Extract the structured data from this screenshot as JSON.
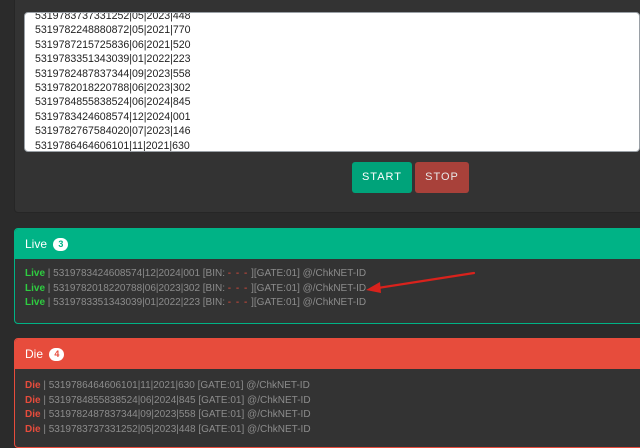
{
  "input": {
    "lines": [
      "5319783737331252|05|2023|448",
      "5319782248880872|05|2021|770",
      "5319787215725836|06|2021|520",
      "5319783351343039|01|2022|223",
      "5319782487837344|09|2023|558",
      "5319782018220788|06|2023|302",
      "5319784855838524|06|2024|845",
      "5319783424608574|12|2024|001",
      "5319782767584020|07|2023|146",
      "5319786464606101|11|2021|630"
    ]
  },
  "buttons": {
    "start": "START",
    "stop": "STOP"
  },
  "live": {
    "title": "Live",
    "count": "3",
    "rows": [
      {
        "status": "Live",
        "text": " | 5319783424608574|12|2024|001 [BIN: ",
        "bin": "- - -",
        "suffix": " ][GATE:01] @/ChkNET-ID"
      },
      {
        "status": "Live",
        "text": " | 5319782018220788|06|2023|302 [BIN: ",
        "bin": "- - -",
        "suffix": " ][GATE:01] @/ChkNET-ID"
      },
      {
        "status": "Live",
        "text": " | 5319783351343039|01|2022|223 [BIN: ",
        "bin": "- - -",
        "suffix": " ][GATE:01] @/ChkNET-ID"
      }
    ]
  },
  "die": {
    "title": "Die",
    "count": "4",
    "rows": [
      {
        "status": "Die",
        "text": " | 5319786464606101|11|2021|630 [GATE:01] @/ChkNET-ID"
      },
      {
        "status": "Die",
        "text": " | 5319784855838524|06|2024|845 [GATE:01] @/ChkNET-ID"
      },
      {
        "status": "Die",
        "text": " | 5319782487837344|09|2023|558 [GATE:01] @/ChkNET-ID"
      },
      {
        "status": "Die",
        "text": " | 5319783737331252|05|2023|448 [GATE:01] @/ChkNET-ID"
      }
    ]
  },
  "colors": {
    "live_accent": "#00b386",
    "die_accent": "#e74c3c",
    "start_button": "#00a37a",
    "stop_button": "#a8413a",
    "annotation_arrow": "#d9221c"
  },
  "icons": {
    "annotation": "red-arrow-icon"
  }
}
